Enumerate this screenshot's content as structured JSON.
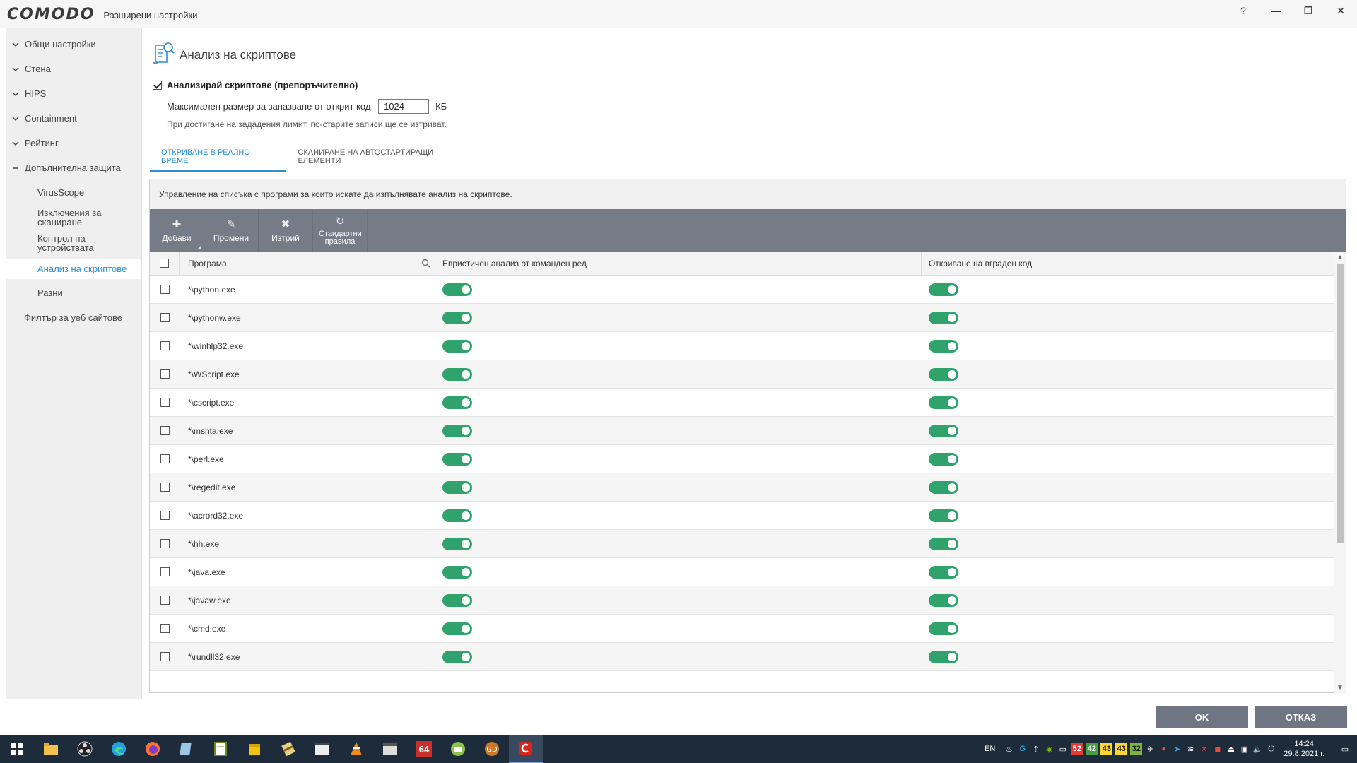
{
  "window": {
    "brand": "COMODO",
    "title": "Разширени настройки",
    "help": "?",
    "minimize": "—",
    "restore": "❐",
    "close": "✕"
  },
  "sidebar": {
    "groups": [
      "Общи настройки",
      "Стена",
      "HIPS",
      "Containment",
      "Рейтинг",
      "Допълнителна защита"
    ],
    "subitems": [
      "VirusScope",
      "Изключения за сканиране",
      "Контрол на устройствата",
      "Анализ на скриптове",
      "Разни"
    ],
    "bottom": "Филтър за уеб сайтове"
  },
  "page": {
    "title": "Анализ на скриптове",
    "enable_label": "Анализирай скриптове (препоръчително)",
    "max_size_label": "Максимален размер за запазване от открит код:",
    "max_size_value": "1024",
    "max_size_unit": "КБ",
    "note": "При достигане на зададения лимит, по-старите записи ще се изтриват."
  },
  "tabs": [
    "ОТКРИВАНЕ В РЕАЛНО ВРЕМЕ",
    "СКАНИРАНЕ НА АВТОСТАРТИРАЩИ ЕЛЕМЕНТИ"
  ],
  "panel": {
    "description": "Управление на списъка с програми за които искате да изпълнявате анализ на скриптове.",
    "toolbar": {
      "add": "Добави",
      "edit": "Промени",
      "delete": "Изтрий",
      "defaults": "Стандартни правила"
    },
    "columns": {
      "program": "Програма",
      "heuristic": "Евристичен анализ от команден ред",
      "embedded": "Откриване на вграден код"
    },
    "rows": [
      {
        "program": "*\\python.exe",
        "heuristic": true,
        "embedded": true
      },
      {
        "program": "*\\pythonw.exe",
        "heuristic": true,
        "embedded": true
      },
      {
        "program": "*\\winhlp32.exe",
        "heuristic": true,
        "embedded": true
      },
      {
        "program": "*\\WScript.exe",
        "heuristic": true,
        "embedded": true
      },
      {
        "program": "*\\cscript.exe",
        "heuristic": true,
        "embedded": true
      },
      {
        "program": "*\\mshta.exe",
        "heuristic": true,
        "embedded": true
      },
      {
        "program": "*\\perl.exe",
        "heuristic": true,
        "embedded": true
      },
      {
        "program": "*\\regedit.exe",
        "heuristic": true,
        "embedded": true
      },
      {
        "program": "*\\acrord32.exe",
        "heuristic": true,
        "embedded": true
      },
      {
        "program": "*\\hh.exe",
        "heuristic": true,
        "embedded": true
      },
      {
        "program": "*\\java.exe",
        "heuristic": true,
        "embedded": true
      },
      {
        "program": "*\\javaw.exe",
        "heuristic": true,
        "embedded": true
      },
      {
        "program": "*\\cmd.exe",
        "heuristic": true,
        "embedded": true
      },
      {
        "program": "*\\rundll32.exe",
        "heuristic": true,
        "embedded": true
      }
    ]
  },
  "footer": {
    "ok": "OK",
    "cancel": "ОТКАЗ"
  },
  "taskbar": {
    "apps": [
      "start-icon",
      "file-explorer-icon",
      "obs-icon",
      "edge-icon",
      "firefox-icon",
      "notepad-icon",
      "notepadpp-icon",
      "archive-icon",
      "winrar-icon",
      "media-player-icon",
      "vlc-icon",
      "video-editor-icon",
      "aida64-icon",
      "android-icon",
      "game-icon",
      "comodo-icon"
    ],
    "aida_label": "64",
    "lang": "EN",
    "temps": [
      {
        "value": "52",
        "color": "#e53935"
      },
      {
        "value": "42",
        "color": "#43a047"
      },
      {
        "value": "43",
        "color": "#fdd835"
      },
      {
        "value": "43",
        "color": "#fdd835"
      },
      {
        "value": "32",
        "color": "#7cb342"
      }
    ],
    "time": "14:24",
    "date": "29.8.2021 г."
  },
  "colors": {
    "accent": "#2d8fd5",
    "toggle_on": "#2fa36b",
    "toolbar": "#757b87",
    "button": "#6f7582"
  }
}
